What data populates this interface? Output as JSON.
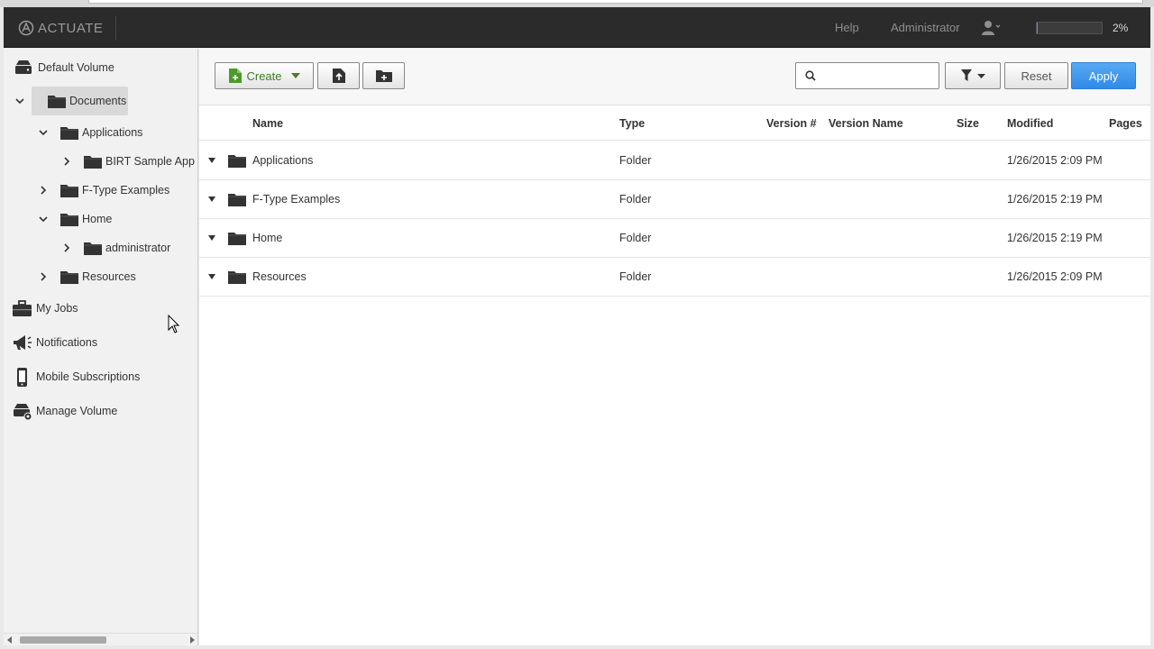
{
  "header": {
    "logo_text": "ACTUATE",
    "help_label": "Help",
    "user_label": "Administrator",
    "progress_percent_label": "2%",
    "progress_fraction": 0.02
  },
  "sidebar": {
    "default_volume_label": "Default Volume",
    "tree": {
      "documents": "Documents",
      "applications": "Applications",
      "birt_sample_app": "BIRT Sample App",
      "f_type_examples": "F-Type Examples",
      "home": "Home",
      "administrator": "administrator",
      "resources": "Resources"
    },
    "my_jobs": "My Jobs",
    "notifications": "Notifications",
    "mobile_subscriptions": "Mobile Subscriptions",
    "manage_volume": "Manage Volume"
  },
  "toolbar": {
    "create_label": "Create",
    "search_placeholder": "",
    "reset_label": "Reset",
    "apply_label": "Apply"
  },
  "table": {
    "columns": {
      "name": "Name",
      "type": "Type",
      "version_num": "Version #",
      "version_name": "Version Name",
      "size": "Size",
      "modified": "Modified",
      "pages": "Pages"
    },
    "rows": [
      {
        "name": "Applications",
        "type": "Folder",
        "modified": "1/26/2015 2:09 PM"
      },
      {
        "name": "F-Type Examples",
        "type": "Folder",
        "modified": "1/26/2015 2:19 PM"
      },
      {
        "name": "Home",
        "type": "Folder",
        "modified": "1/26/2015 2:19 PM"
      },
      {
        "name": "Resources",
        "type": "Folder",
        "modified": "1/26/2015 2:09 PM"
      }
    ]
  },
  "colors": {
    "header_bg": "#2b2b2b",
    "apply_blue": "#2f8ae6",
    "create_green": "#3e7e25",
    "folder_icon": "#333333"
  }
}
